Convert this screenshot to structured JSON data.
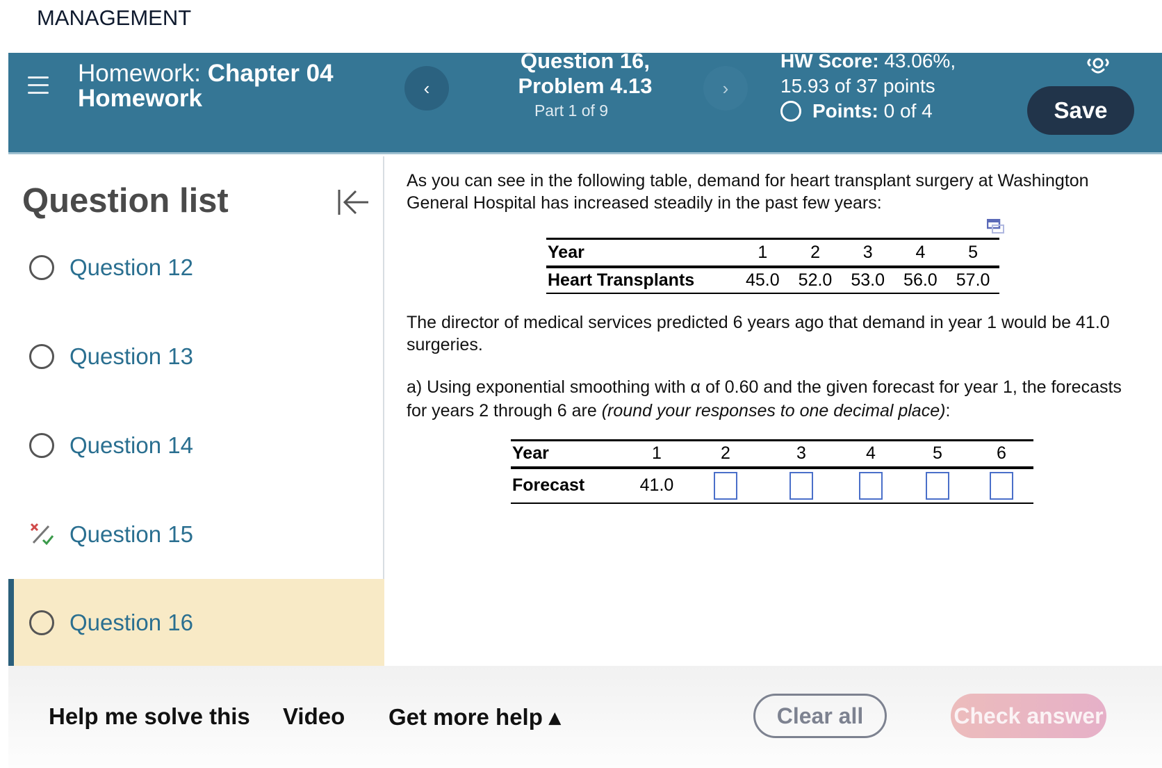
{
  "course_label": "MANAGEMENT",
  "header": {
    "hw_prefix": "Homework:",
    "hw_name_line1": "Chapter 04",
    "hw_name_line2": "Homework",
    "question_title_line1": "Question 16,",
    "question_title_line2": "Problem 4.13",
    "part": "Part 1 of 9",
    "hw_score_label": "HW Score:",
    "hw_score_value": "43.06%,",
    "hw_points": "15.93 of 37 points",
    "points_label": "Points:",
    "points_value": "0 of 4",
    "prev_glyph": "‹",
    "next_glyph": "›",
    "save_label": "Save",
    "accent_color": "#357695"
  },
  "sidebar": {
    "title": "Question list",
    "items": [
      {
        "label": "Question 12",
        "status": "not-attempted"
      },
      {
        "label": "Question 13",
        "status": "not-attempted"
      },
      {
        "label": "Question 14",
        "status": "not-attempted"
      },
      {
        "label": "Question 15",
        "status": "partially-correct"
      },
      {
        "label": "Question 16",
        "status": "not-attempted",
        "active": true
      }
    ]
  },
  "question": {
    "intro": "As you can see in the following table, demand for heart transplant surgery at Washington General Hospital has increased steadily in the past few years:",
    "demand_table": {
      "header_label": "Year",
      "years": [
        "1",
        "2",
        "3",
        "4",
        "5"
      ],
      "row_label": "Heart Transplants",
      "values": [
        "45.0",
        "52.0",
        "53.0",
        "56.0",
        "57.0"
      ]
    },
    "director_text": "The director of medical services predicted 6 years ago that demand in year 1 would be 41.0 surgeries.",
    "part_a_text": "a) Using exponential smoothing with α of 0.60 and the given forecast for year 1, the forecasts for years 2 through 6 are ",
    "part_a_italic": "(round your responses to one decimal place)",
    "part_a_end": ":",
    "forecast_table": {
      "header_label": "Year",
      "years": [
        "1",
        "2",
        "3",
        "4",
        "5",
        "6"
      ],
      "row_label": "Forecast",
      "year1_value": "41.0",
      "inputs": [
        "",
        "",
        "",
        "",
        ""
      ]
    }
  },
  "footer": {
    "help_solve": "Help me solve this",
    "video": "Video",
    "more_help": "Get more help ▴",
    "clear_all": "Clear all",
    "check_answer": "Check answer"
  }
}
